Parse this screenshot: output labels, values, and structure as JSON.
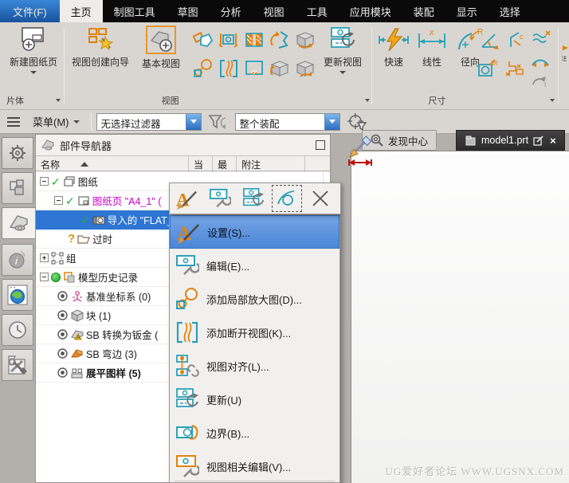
{
  "menubar": {
    "items": [
      {
        "label": "文件(F)"
      },
      {
        "label": "主页"
      },
      {
        "label": "制图工具"
      },
      {
        "label": "草图"
      },
      {
        "label": "分析"
      },
      {
        "label": "视图"
      },
      {
        "label": "工具"
      },
      {
        "label": "应用模块"
      },
      {
        "label": "装配"
      },
      {
        "label": "显示"
      },
      {
        "label": "选择"
      }
    ]
  },
  "ribbon": {
    "sheet_group": {
      "new_sheet": "新建图纸页",
      "section": "片体"
    },
    "view_group": {
      "wizard": "视图创建向导",
      "base_view": "基本视图",
      "update_view": "更新视图",
      "section": "视图"
    },
    "dim_group": {
      "rapid": "快速",
      "linear": "线性",
      "radial": "径向",
      "section": "尺寸"
    }
  },
  "quickbar": {
    "menu": "菜单(M)",
    "filter": "无选择过滤器",
    "scope": "整个装配"
  },
  "navigator": {
    "title": "部件导航器",
    "columns": {
      "name": "名称",
      "cur": "当",
      "last": "最",
      "note": "附注"
    },
    "rows": [
      {
        "label": "图纸"
      },
      {
        "label": "图纸页 \"A4_1\" ("
      },
      {
        "label": "导入的 \"FLAT_P"
      },
      {
        "label": "过时"
      },
      {
        "label": "组"
      },
      {
        "label": "模型历史记录"
      },
      {
        "label": "基准坐标系 (0)"
      },
      {
        "label": "块 (1)"
      },
      {
        "label": "SB 转换为钣金 ("
      },
      {
        "label": "SB 弯边 (3)"
      },
      {
        "label": "展平图样 (5)"
      }
    ]
  },
  "context_menu": {
    "items": [
      {
        "label": "设置(S)..."
      },
      {
        "label": "编辑(E)..."
      },
      {
        "label": "添加局部放大图(D)..."
      },
      {
        "label": "添加断开视图(K)..."
      },
      {
        "label": "视图对齐(L)..."
      },
      {
        "label": "更新(U)"
      },
      {
        "label": "边界(B)..."
      },
      {
        "label": "视图相关编辑(V)..."
      }
    ]
  },
  "tabs": {
    "discover": "发现中心",
    "model": "model1.prt"
  },
  "watermark": "UG爱好者论坛 WWW.UGSNX.COM",
  "colors": {
    "accent_orange": "#e0820f",
    "accent_cyan": "#2aa0b8",
    "selection_blue": "#2e75d4",
    "tree_magenta": "#cc00cc",
    "check_green": "#1faf1f"
  }
}
